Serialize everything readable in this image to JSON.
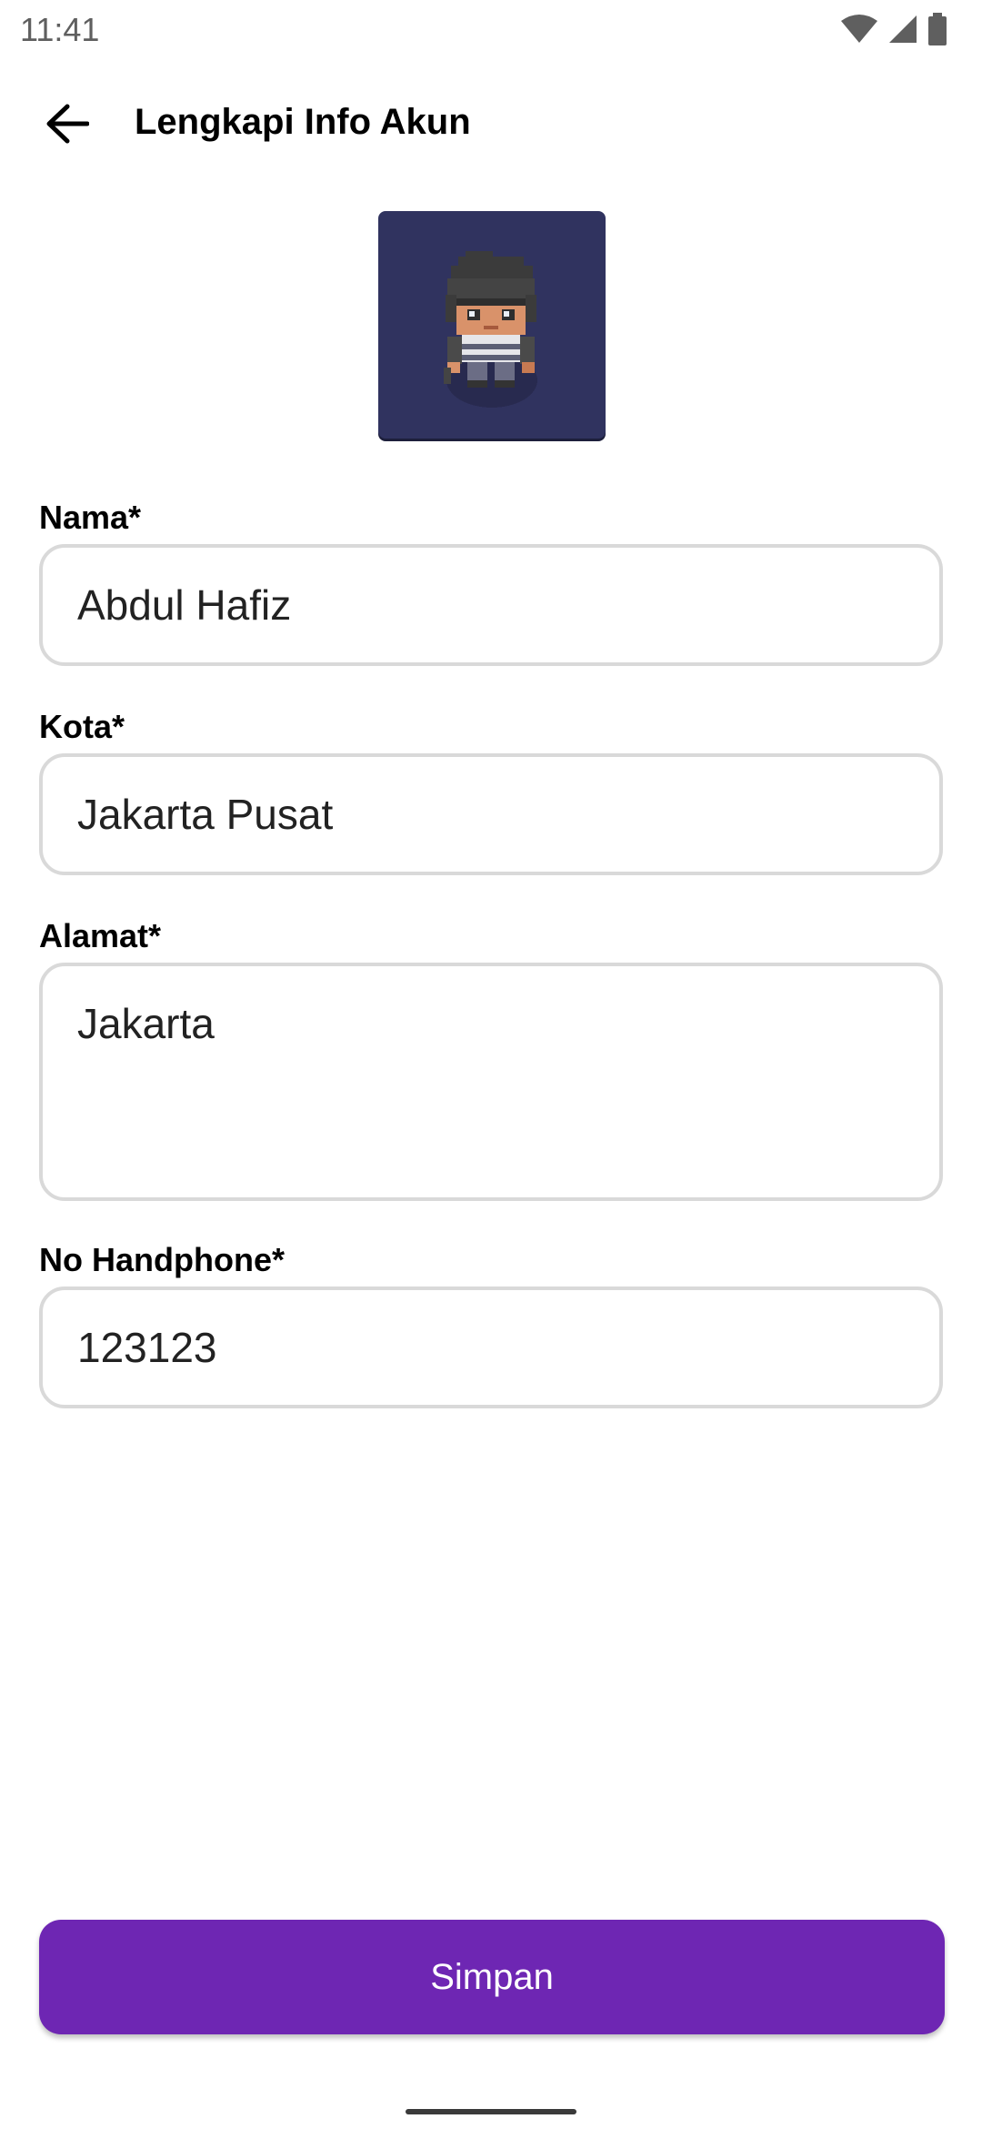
{
  "status_bar": {
    "time": "11:41",
    "icons": [
      "wifi-icon",
      "signal-icon",
      "battery-icon"
    ]
  },
  "app_bar": {
    "title": "Lengkapi Info Akun",
    "back_icon": "arrow-back-icon"
  },
  "avatar": {
    "icon": "pixel-character-avatar",
    "background": "#30335f"
  },
  "form": {
    "name": {
      "label": "Nama*",
      "value": "Abdul Hafiz"
    },
    "city": {
      "label": "Kota*",
      "value": "Jakarta Pusat"
    },
    "address": {
      "label": "Alamat*",
      "value": "Jakarta"
    },
    "phone": {
      "label": "No Handphone*",
      "value": "123123"
    }
  },
  "actions": {
    "save_label": "Simpan",
    "save_color": "#6e26b3"
  }
}
